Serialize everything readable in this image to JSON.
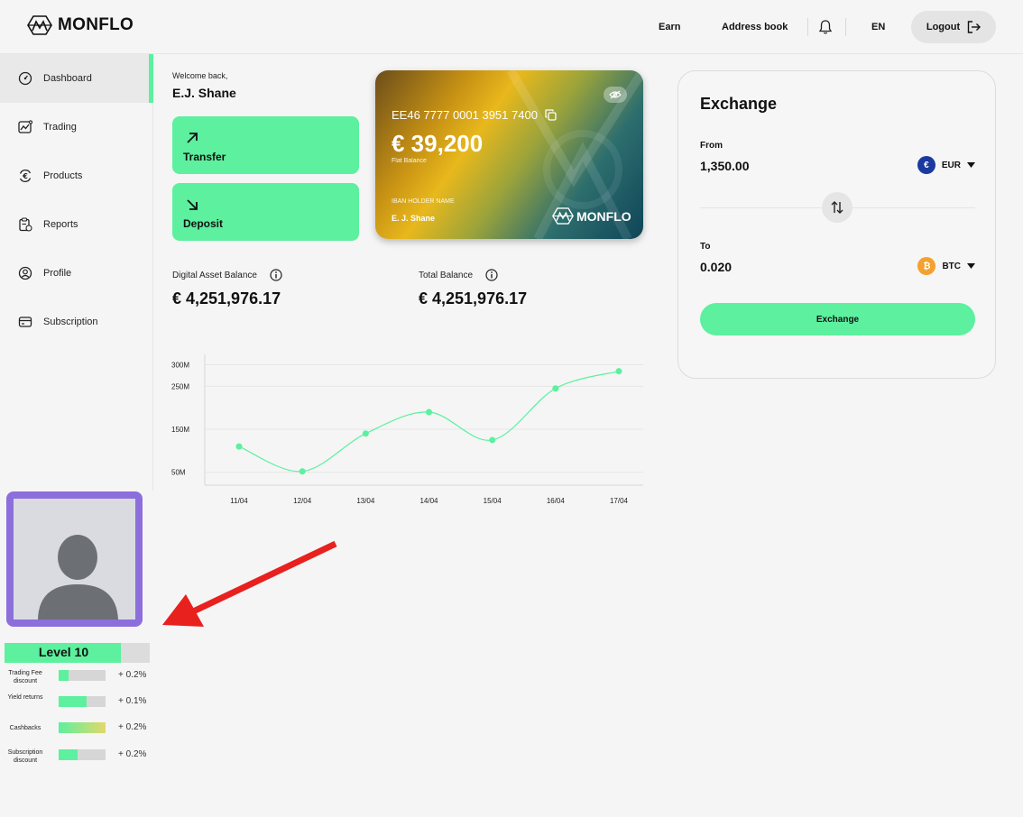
{
  "brand": {
    "name": "MONFLO"
  },
  "header": {
    "earn": "Earn",
    "address_book": "Address book",
    "language": "EN",
    "logout": "Logout"
  },
  "sidebar": {
    "items": [
      {
        "label": "Dashboard",
        "icon": "dashboard-gauge-icon",
        "active": true
      },
      {
        "label": "Trading",
        "icon": "chart-trend-icon"
      },
      {
        "label": "Products",
        "icon": "euro-exchange-icon"
      },
      {
        "label": "Reports",
        "icon": "report-clipboard-icon"
      },
      {
        "label": "Profile",
        "icon": "user-circle-icon"
      },
      {
        "label": "Subscription",
        "icon": "card-icon"
      }
    ]
  },
  "welcome": {
    "greeting": "Welcome back,",
    "name": "E.J. Shane"
  },
  "actions": {
    "transfer": "Transfer",
    "deposit": "Deposit"
  },
  "card": {
    "iban": "EE46 7777 0001 3951 7400",
    "balance": "€ 39,200",
    "balance_label": "Flat Balance",
    "holder_label": "IBAN HOLDER NAME",
    "holder_name": "E. J. Shane",
    "brand": "MONFLO"
  },
  "balances": {
    "digital_label": "Digital Asset Balance",
    "digital_value": "€ 4,251,976.17",
    "total_label": "Total Balance",
    "total_value": "€ 4,251,976.17"
  },
  "chart_data": {
    "type": "line",
    "x": [
      "11/04",
      "12/04",
      "13/04",
      "14/04",
      "15/04",
      "16/04",
      "17/04"
    ],
    "values": [
      110,
      52,
      140,
      190,
      125,
      245,
      285
    ],
    "yticks": [
      50,
      150,
      250,
      300
    ],
    "ytick_labels": [
      "50M",
      "150M",
      "250M",
      "300M"
    ],
    "ylim": [
      20,
      320
    ],
    "grid": true,
    "color": "#5cf09f"
  },
  "exchange": {
    "title": "Exchange",
    "from_label": "From",
    "from_value": "1,350.00",
    "from_currency": "EUR",
    "to_label": "To",
    "to_value": "0.020",
    "to_currency": "BTC",
    "button": "Exchange"
  },
  "level": {
    "label": "Level 10",
    "progress": 0.8,
    "perks": [
      {
        "label": "Trading Fee discount",
        "value": "+ 0.2%",
        "fill": 0.22
      },
      {
        "label": "Yield returns",
        "value": "+ 0.1%",
        "fill": 0.6
      },
      {
        "label": "Cashbacks",
        "value": "+ 0.2%",
        "fill": 1.0
      },
      {
        "label": "Subscription discount",
        "value": "+ 0.2%",
        "fill": 0.4
      }
    ]
  },
  "colors": {
    "accent": "#5cf09f",
    "avatar_frame": "#8c6fdc",
    "annotation_arrow": "#e8201e"
  }
}
